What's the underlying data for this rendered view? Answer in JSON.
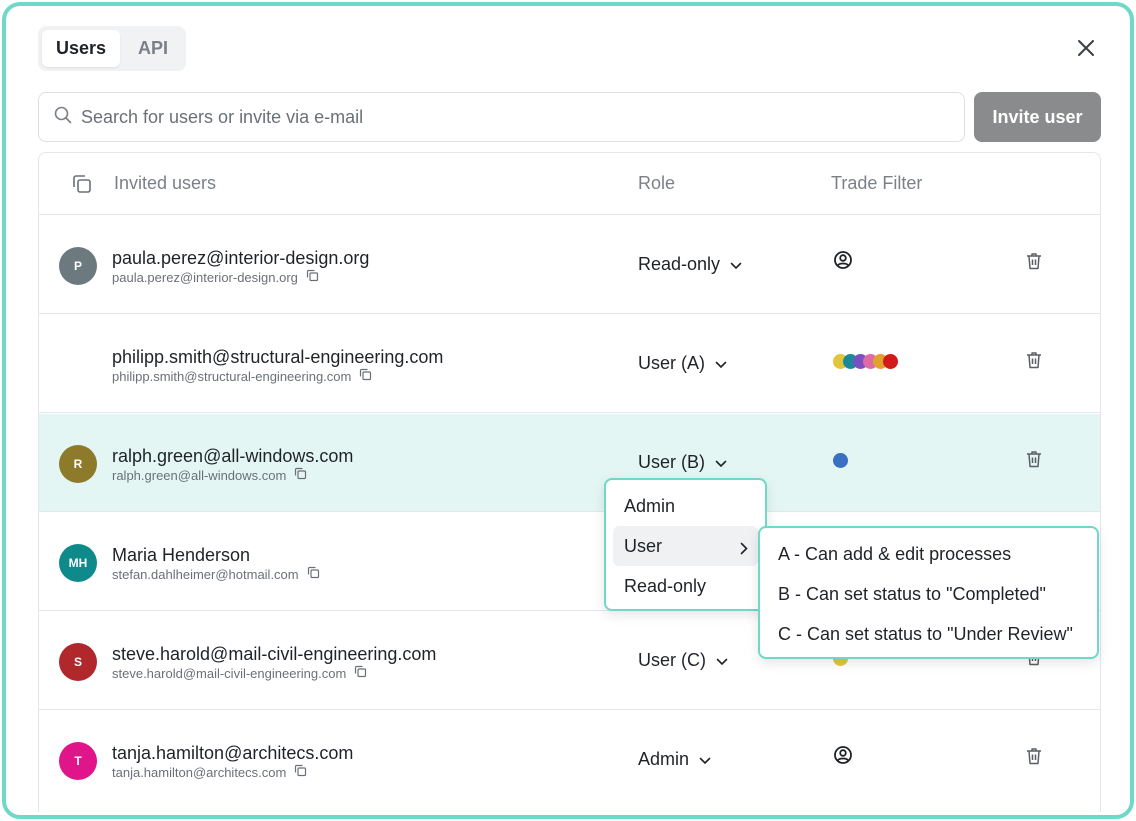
{
  "tabs": [
    {
      "label": "Users",
      "active": true
    },
    {
      "label": "API",
      "active": false
    }
  ],
  "search": {
    "placeholder": "Search for users or invite via e-mail"
  },
  "invite_button": {
    "label": "Invite user"
  },
  "table": {
    "headers": {
      "invited": "Invited users",
      "role": "Role",
      "trade": "Trade Filter"
    },
    "rows": [
      {
        "avatar": "P",
        "avatar_color": "#6c7a80",
        "name": "paula.perez@interior-design.org",
        "email": "paula.perez@interior-design.org",
        "role": "Read-only",
        "trade": "all-icon"
      },
      {
        "avatar": "",
        "avatar_color": "",
        "name": "philipp.smith@structural-engineering.com",
        "email": "philipp.smith@structural-engineering.com",
        "role": "User (A)",
        "trade_colors": [
          "#e3c53c",
          "#1a8a9a",
          "#7c4fc0",
          "#e06aa4",
          "#e0a22c",
          "#d11a1a"
        ]
      },
      {
        "avatar": "R",
        "avatar_color": "#8d7a2a",
        "name": "ralph.green@all-windows.com",
        "email": "ralph.green@all-windows.com",
        "role": "User (B)",
        "trade_colors": [
          "#3b6fc2"
        ],
        "highlighted": true
      },
      {
        "avatar": "MH",
        "avatar_color": "#0f8a8a",
        "name": "Maria Henderson",
        "email": "stefan.dahlheimer@hotmail.com",
        "role": "",
        "trade_colors": []
      },
      {
        "avatar": "S",
        "avatar_color": "#b0282c",
        "name": "steve.harold@mail-civil-engineering.com",
        "email": "steve.harold@mail-civil-engineering.com",
        "role": "User (C)",
        "trade_colors": [
          "#e3c53c"
        ]
      },
      {
        "avatar": "T",
        "avatar_color": "#e0158a",
        "name": "tanja.hamilton@architecs.com",
        "email": "tanja.hamilton@architecs.com",
        "role": "Admin",
        "trade": "all-icon"
      }
    ]
  },
  "role_menu": {
    "items": [
      "Admin",
      "User",
      "Read-only"
    ],
    "active": "User"
  },
  "user_submenu": {
    "items": [
      "A - Can add & edit processes",
      "B - Can set status to \"Completed\"",
      "C - Can set status to \"Under Review\""
    ]
  },
  "colors": {
    "accent": "#6fd8c9",
    "highlight_row": "#e3f6f3",
    "invite_button": "#8a8b8c"
  },
  "icons": [
    "search-icon",
    "close-icon",
    "copy-icon",
    "chevron-down-icon",
    "chevron-right-icon",
    "trash-icon",
    "user-circle-icon"
  ]
}
